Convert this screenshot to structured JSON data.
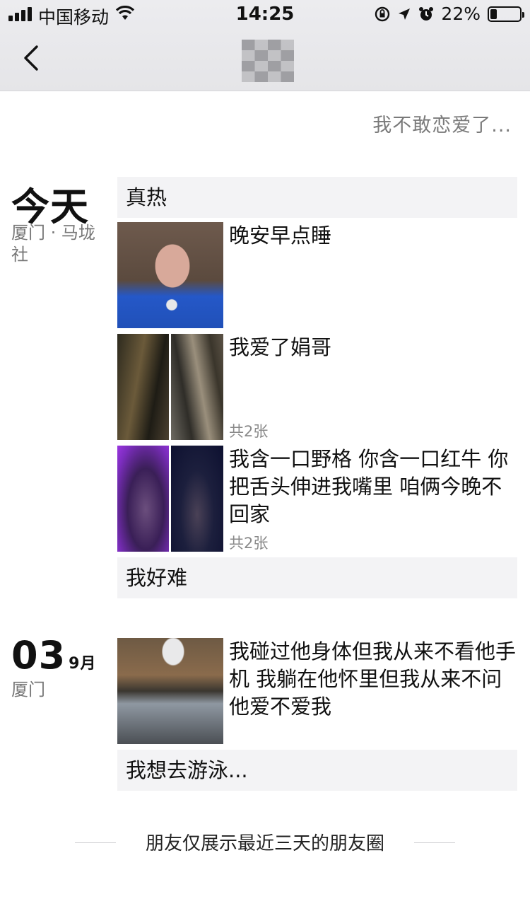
{
  "status_bar": {
    "carrier": "中国移动",
    "time": "14:25",
    "battery_percent": "22%",
    "battery_level": 0.22
  },
  "nav": {
    "back_icon": "chevron-left-icon",
    "title_obscured": true
  },
  "signature": "我不敢恋爱了...",
  "groups": [
    {
      "day": "今天",
      "month": "",
      "location": "厦门 · 马垅社",
      "items": [
        {
          "type": "text",
          "text": "真热"
        },
        {
          "type": "photo",
          "caption": "晚安早点睡",
          "count": ""
        },
        {
          "type": "photo",
          "caption": "我爱了娟哥",
          "count": "共2张"
        },
        {
          "type": "photo",
          "caption": "我含一口野格 你含一口红牛  你把舌头伸进我嘴里 咱俩今晚不回家",
          "count": "共2张"
        },
        {
          "type": "text",
          "text": "我好难"
        }
      ]
    },
    {
      "day": "03",
      "month": "9月",
      "location": "厦门",
      "items": [
        {
          "type": "photo",
          "caption": "我碰过他身体但我从来不看他手机 我躺在他怀里但我从来不问他爱不爱我",
          "count": ""
        },
        {
          "type": "text",
          "text": "我想去游泳..."
        }
      ]
    }
  ],
  "footer": "朋友仅展示最近三天的朋友圈"
}
